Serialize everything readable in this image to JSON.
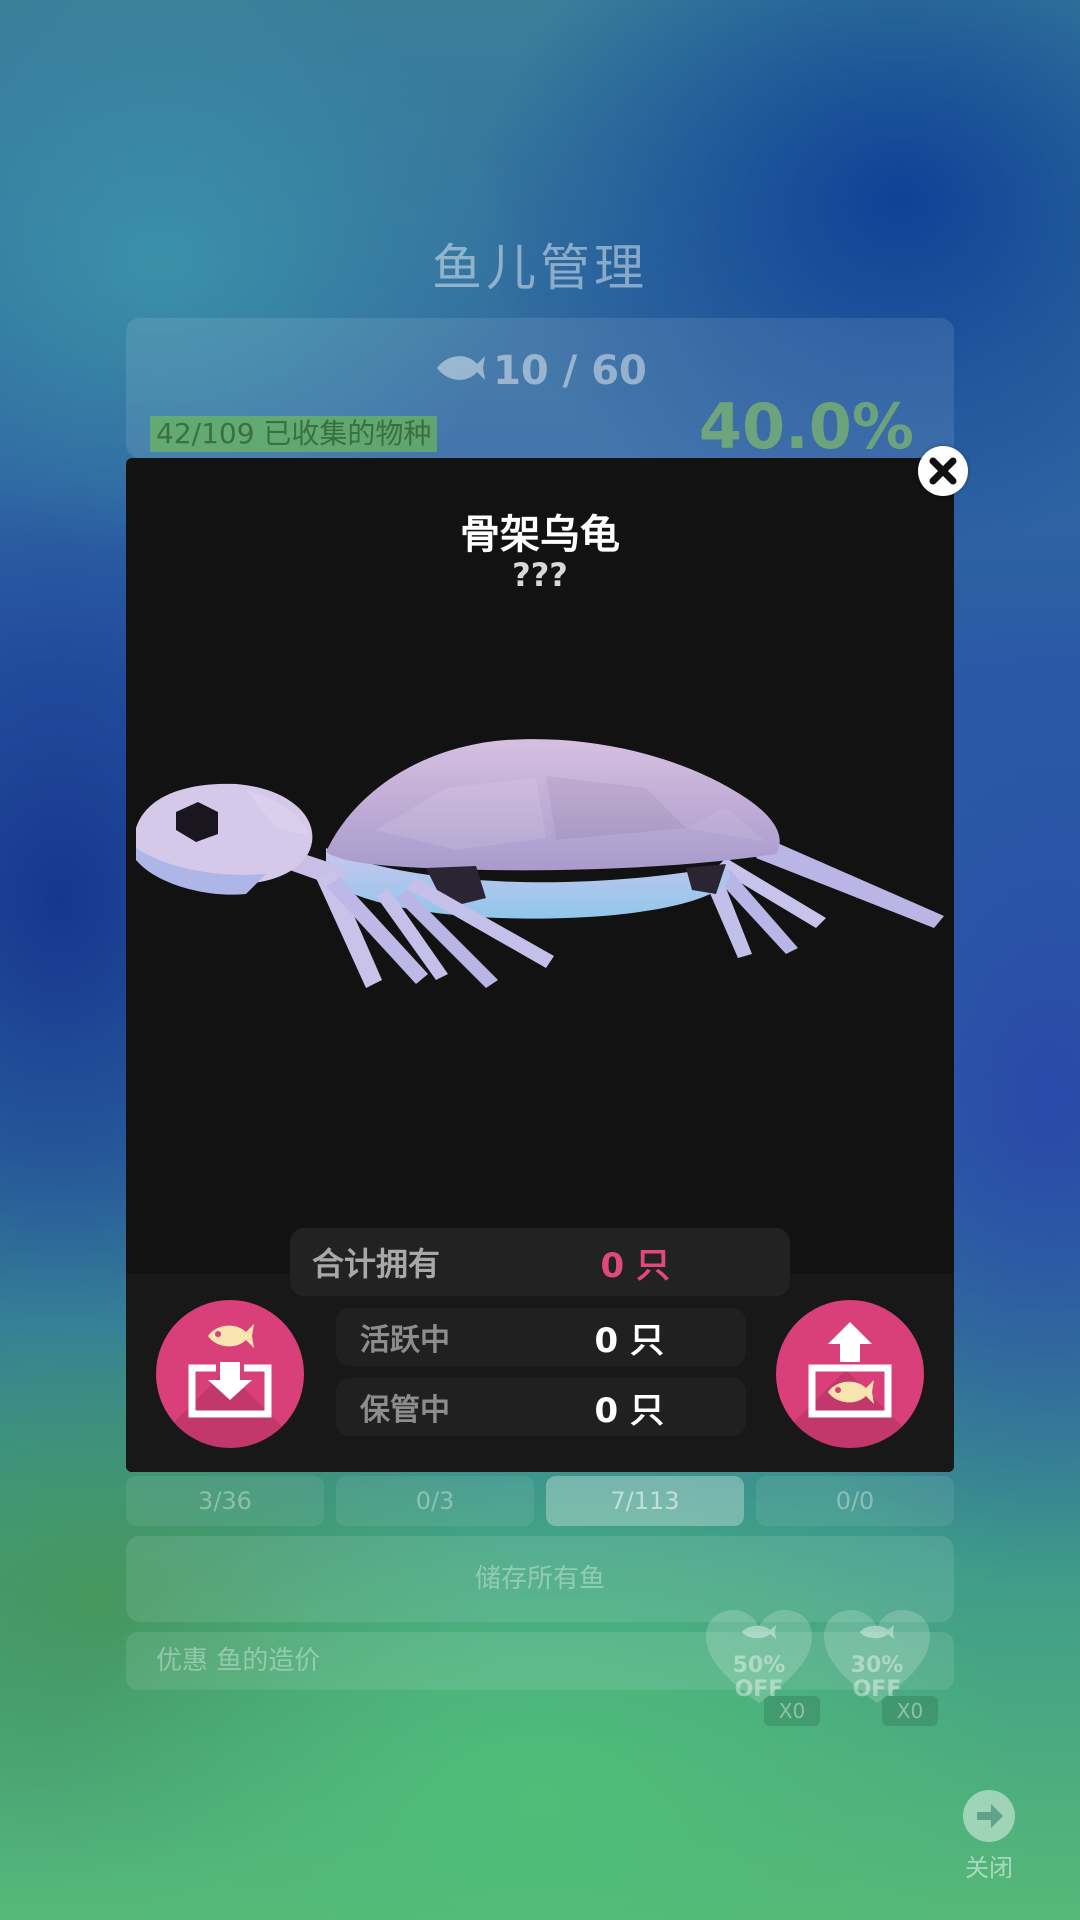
{
  "background": {
    "title": "鱼儿管理",
    "fish_count": "10 / 60",
    "collection_label": "42/109 已收集的物种",
    "collection_percent": "40.0%",
    "tabs": [
      "3/36",
      "0/3",
      "7/113",
      "0/0"
    ],
    "active_tab": 2,
    "store_all_label": "储存所有鱼",
    "discount_label": "优惠 鱼的造价",
    "coupons": [
      {
        "text": "50%",
        "off": "OFF",
        "count": "X0"
      },
      {
        "text": "30%",
        "off": "OFF",
        "count": "X0"
      }
    ],
    "close_label": "关闭"
  },
  "modal": {
    "title": "骨架乌龟",
    "subtitle": "???",
    "stats": {
      "total_label": "合计拥有",
      "total_value": "0 只",
      "active_label": "活跃中",
      "active_value": "0 只",
      "stored_label": "保管中",
      "stored_value": "0 只"
    },
    "buttons": {
      "store_icon": "fish-into-box-icon",
      "release_icon": "fish-out-of-box-icon"
    }
  },
  "colors": {
    "accent": "#d93f78",
    "total_value": "#e0497d",
    "modal_bg": "#121212"
  }
}
